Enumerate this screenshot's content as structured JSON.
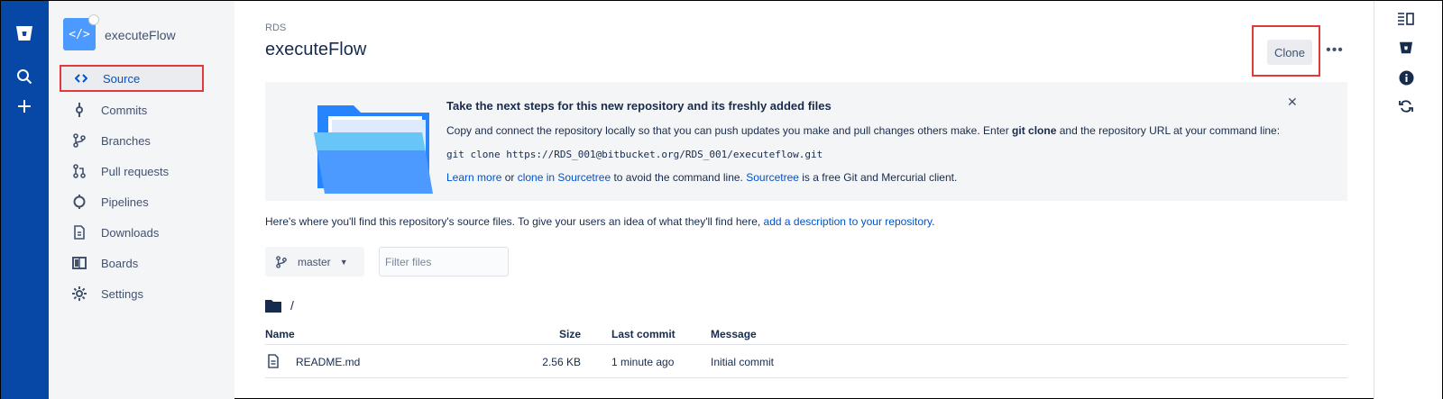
{
  "sidebar": {
    "repo_name": "executeFlow",
    "repo_avatar_glyph": "</>",
    "items": [
      {
        "label": "Source",
        "icon": "code-icon",
        "active": true
      },
      {
        "label": "Commits",
        "icon": "commit-icon"
      },
      {
        "label": "Branches",
        "icon": "branch-icon"
      },
      {
        "label": "Pull requests",
        "icon": "pull-request-icon"
      },
      {
        "label": "Pipelines",
        "icon": "pipelines-icon"
      },
      {
        "label": "Downloads",
        "icon": "download-icon"
      },
      {
        "label": "Boards",
        "icon": "boards-icon"
      },
      {
        "label": "Settings",
        "icon": "gear-icon"
      }
    ]
  },
  "header": {
    "breadcrumb": "RDS",
    "title": "executeFlow",
    "clone_label": "Clone",
    "more_label": "•••"
  },
  "banner": {
    "title": "Take the next steps for this new repository and its freshly added files",
    "text_before": "Copy and connect the repository locally so that you can push updates you make and pull changes others make. Enter ",
    "text_bold": "git clone",
    "text_after": " and the repository URL at your command line:",
    "command": "git clone https://RDS_001@bitbucket.org/RDS_001/executeflow.git",
    "link_learn_more": "Learn more",
    "text_or": " or ",
    "link_clone_sourcetree": "clone in Sourcetree",
    "text_avoid": " to avoid the command line. ",
    "link_sourcetree": "Sourcetree",
    "text_client": " is a free Git and Mercurial client.",
    "close_glyph": "✕"
  },
  "intro": {
    "text": "Here's where you'll find this repository's source files. To give your users an idea of what they'll find here, ",
    "link": "add a description to your repository",
    "end": "."
  },
  "toolbar": {
    "branch": "master",
    "filter_placeholder": "Filter files"
  },
  "path": "/",
  "files": {
    "headers": {
      "name": "Name",
      "size": "Size",
      "last_commit": "Last commit",
      "message": "Message"
    },
    "rows": [
      {
        "name": "README.md",
        "size": "2.56 KB",
        "last_commit": "1 minute ago",
        "message": "Initial commit"
      }
    ]
  },
  "colors": {
    "global_nav": "#0747A6",
    "link": "#0052CC",
    "highlight": "#E03A3A"
  }
}
